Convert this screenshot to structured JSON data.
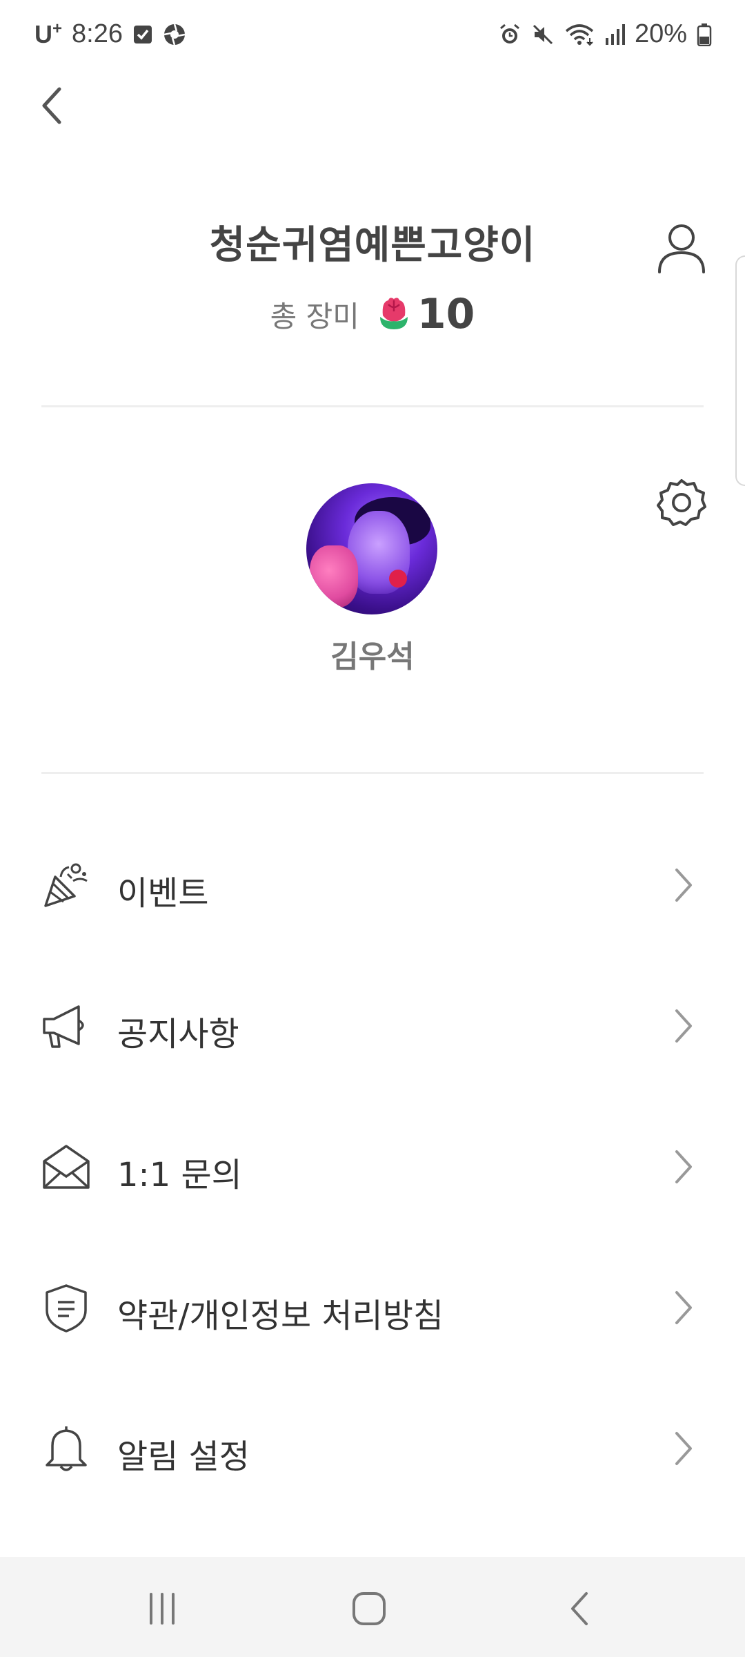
{
  "status_bar": {
    "carrier": "U",
    "carrier_sup": "+",
    "time": "8:26",
    "battery": "20%",
    "icons": [
      "checkbox-icon",
      "aperture-icon",
      "alarm-icon",
      "mute-icon",
      "wifi-icon",
      "signal-icon",
      "battery-icon"
    ]
  },
  "header": {
    "back_icon": "chevron-left-icon",
    "user_icon": "person-icon"
  },
  "profile": {
    "nickname": "청순귀염예쁜고양이",
    "rose_label": "총 장미",
    "rose_icon": "rose-icon",
    "rose_count": "10",
    "settings_icon": "gear-icon",
    "user_name": "김우석"
  },
  "menu": {
    "items": [
      {
        "label": "이벤트",
        "icon": "party-popper-icon"
      },
      {
        "label": "공지사항",
        "icon": "megaphone-icon"
      },
      {
        "label": "1:1 문의",
        "icon": "envelope-icon"
      },
      {
        "label": "약관/개인정보 처리방침",
        "icon": "shield-document-icon"
      },
      {
        "label": "알림 설정",
        "icon": "bell-icon"
      }
    ]
  },
  "nav_bar": {
    "recents_icon": "recents-icon",
    "home_icon": "home-icon",
    "back_icon": "back-icon"
  },
  "colors": {
    "text_primary": "#333333",
    "text_secondary": "#777777",
    "divider": "#eeeeee",
    "nav_background": "#f4f4f4"
  }
}
